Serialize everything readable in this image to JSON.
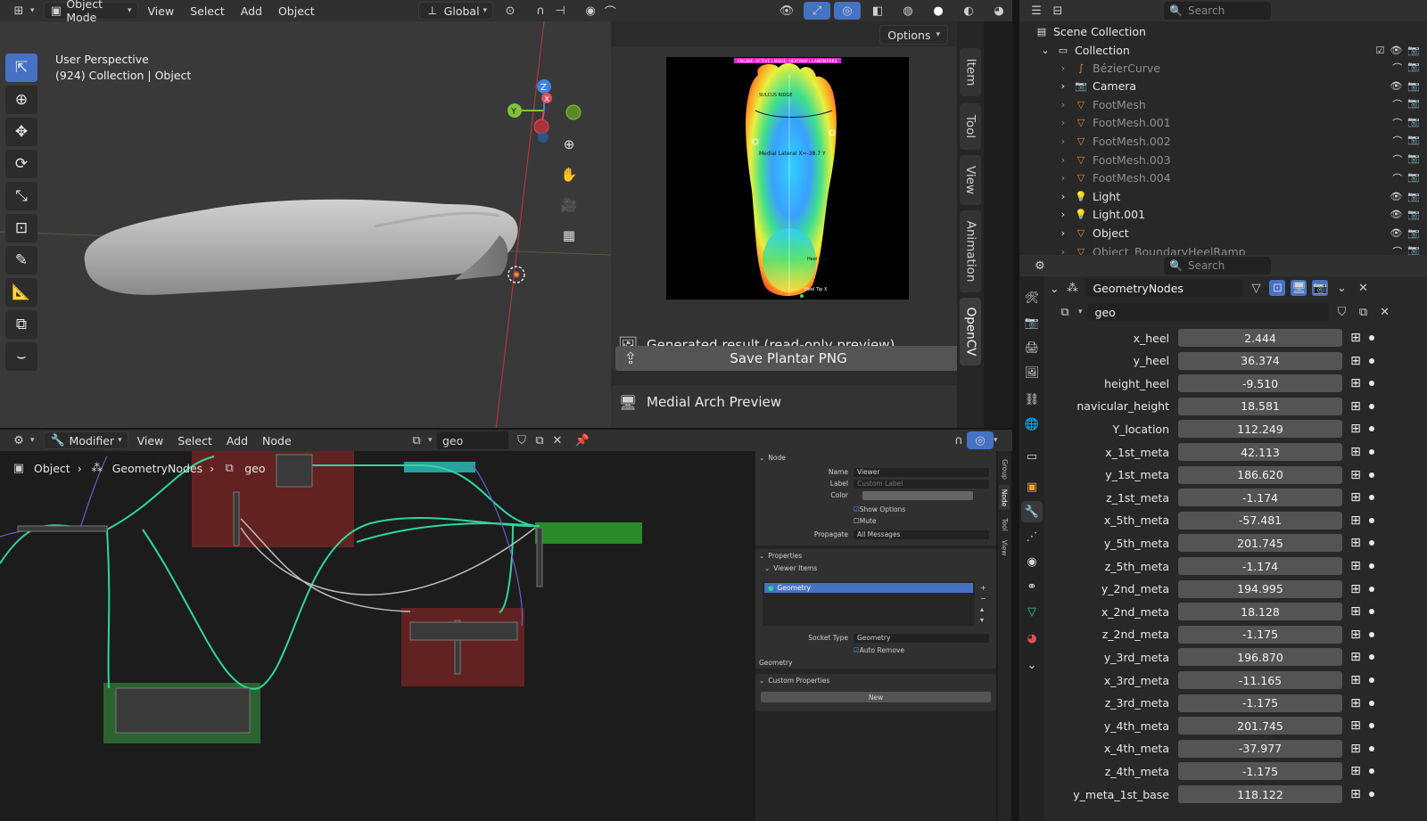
{
  "header": {
    "mode": "Object Mode",
    "menus": [
      "View",
      "Select",
      "Add",
      "Object"
    ],
    "orientation": "Global"
  },
  "viewport": {
    "perspective": "User Perspective",
    "collection_info": "(924) Collection | Object",
    "options_label": "Options"
  },
  "npanel": {
    "tabs": [
      "Item",
      "Tool",
      "View",
      "Animation",
      "OpenCV"
    ],
    "active_tab": "OpenCV",
    "preview_label": "Generated result (read-only preview)",
    "save_button": "Save Plantar PNG",
    "medial_section": "Medial Arch Preview",
    "image_overlay": {
      "top_banner": "ENGINE: ACTIVE | MODE: HEATMAP | LANDMARKS",
      "ridge": "SULCUS RIDGE",
      "lateral": "Medial Lateral X=-38.7 Y",
      "heel_cup": "Heel Cup",
      "heel_tip": "Heel Tip X"
    }
  },
  "node_editor": {
    "type_label": "Modifier",
    "menus": [
      "View",
      "Select",
      "Add",
      "Node"
    ],
    "tree_name": "geo",
    "breadcrumb": [
      "Object",
      "GeometryNodes",
      "geo"
    ],
    "side": {
      "node_section": "Node",
      "name_label": "Name",
      "name_value": "Viewer",
      "label_label": "Label",
      "label_placeholder": "Custom Label",
      "color_label": "Color",
      "show_options": "Show Options",
      "mute": "Mute",
      "propagate_label": "Propagate",
      "propagate_value": "All Messages",
      "properties_section": "Properties",
      "viewer_items": "Viewer Items",
      "viewer_item": "Geometry",
      "socket_type_label": "Socket Type",
      "socket_type_value": "Geometry",
      "auto_remove": "Auto Remove",
      "geometry_label": "Geometry",
      "custom_props": "Custom Properties",
      "new_button": "New",
      "tabs": [
        "Group",
        "Node",
        "Tool",
        "View"
      ]
    }
  },
  "outliner": {
    "search_placeholder": "Search",
    "scene_collection": "Scene Collection",
    "collection": "Collection",
    "items": [
      {
        "name": "BézierCurve",
        "icon": "curve-icon",
        "dim": true
      },
      {
        "name": "Camera",
        "icon": "camera-icon",
        "dim": false
      },
      {
        "name": "FootMesh",
        "icon": "mesh-icon",
        "dim": true
      },
      {
        "name": "FootMesh.001",
        "icon": "mesh-icon",
        "dim": true
      },
      {
        "name": "FootMesh.002",
        "icon": "mesh-icon",
        "dim": true
      },
      {
        "name": "FootMesh.003",
        "icon": "mesh-icon",
        "dim": true
      },
      {
        "name": "FootMesh.004",
        "icon": "mesh-icon",
        "dim": true
      },
      {
        "name": "Light",
        "icon": "light-icon",
        "dim": false
      },
      {
        "name": "Light.001",
        "icon": "light-icon",
        "dim": false
      },
      {
        "name": "Object",
        "icon": "mesh-icon",
        "dim": false
      },
      {
        "name": "Object_BoundaryHeelRamp",
        "icon": "mesh-icon",
        "dim": true
      }
    ]
  },
  "properties": {
    "search_placeholder": "Search",
    "modifier_name": "GeometryNodes",
    "node_group": "geo",
    "params": [
      {
        "label": "x_heel",
        "value": "2.444"
      },
      {
        "label": "y_heel",
        "value": "36.374"
      },
      {
        "label": "height_heel",
        "value": "-9.510"
      },
      {
        "label": "navicular_height",
        "value": "18.581"
      },
      {
        "label": "Y_location",
        "value": "112.249"
      },
      {
        "label": "x_1st_meta",
        "value": "42.113"
      },
      {
        "label": "y_1st_meta",
        "value": "186.620"
      },
      {
        "label": "z_1st_meta",
        "value": "-1.174"
      },
      {
        "label": "x_5th_meta",
        "value": "-57.481"
      },
      {
        "label": "y_5th_meta",
        "value": "201.745"
      },
      {
        "label": "z_5th_meta",
        "value": "-1.174"
      },
      {
        "label": "y_2nd_meta",
        "value": "194.995"
      },
      {
        "label": "x_2nd_meta",
        "value": "18.128"
      },
      {
        "label": "z_2nd_meta",
        "value": "-1.175"
      },
      {
        "label": "y_3rd_meta",
        "value": "196.870"
      },
      {
        "label": "x_3rd_meta",
        "value": "-11.165"
      },
      {
        "label": "z_3rd_meta",
        "value": "-1.175"
      },
      {
        "label": "y_4th_meta",
        "value": "201.745"
      },
      {
        "label": "x_4th_meta",
        "value": "-37.977"
      },
      {
        "label": "z_4th_meta",
        "value": "-1.175"
      },
      {
        "label": "y_meta_1st_base",
        "value": "118.122"
      }
    ]
  },
  "colors": {
    "accent": "#4672c4",
    "link_green": "#2fd6a0",
    "frame_red": "#6b2424",
    "frame_green": "#2f6b33",
    "gizmo_x": "#e04a5a",
    "gizmo_y": "#7fc23a",
    "gizmo_z": "#3a83e0"
  }
}
